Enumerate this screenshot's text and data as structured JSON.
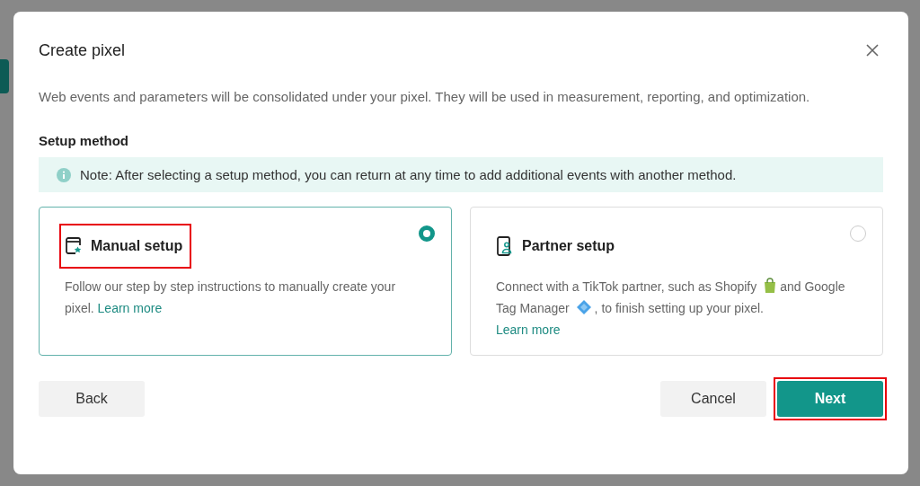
{
  "dialog": {
    "title": "Create pixel",
    "description": "Web events and parameters will be consolidated under your pixel. They will be used in measurement, reporting, and optimization.",
    "section_label": "Setup method",
    "note": "Note: After selecting a setup method, you can return at any time to add additional events with another method."
  },
  "options": [
    {
      "kind": "manual",
      "title": "Manual setup",
      "selected": true,
      "highlighted": true,
      "text_parts": [
        "Follow our step by step instructions to manually create your pixel."
      ],
      "link": "Learn more"
    },
    {
      "kind": "partner",
      "title": "Partner setup",
      "selected": false,
      "highlighted": false,
      "text_parts": [
        "Connect with a TikTok partner, such as Shopify",
        "and Google Tag Manager",
        ", to finish setting up your pixel."
      ],
      "link": "Learn more"
    }
  ],
  "footer": {
    "back": "Back",
    "cancel": "Cancel",
    "next": "Next",
    "next_highlighted": true
  }
}
